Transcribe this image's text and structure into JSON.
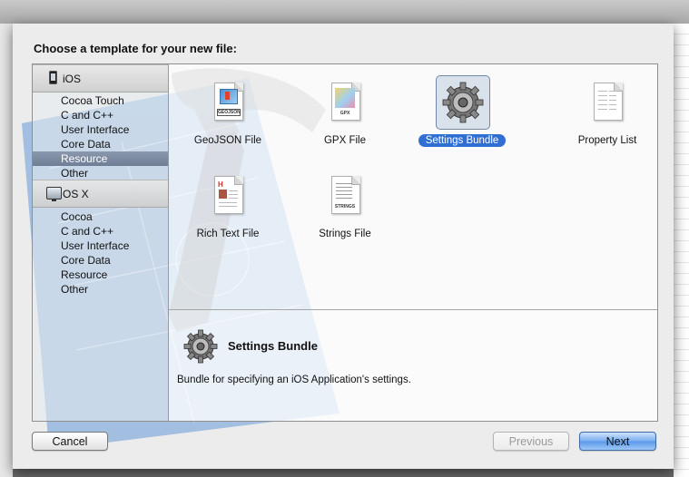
{
  "dialog": {
    "title": "Choose a template for your new file:"
  },
  "sidebar": {
    "sections": [
      {
        "name": "iOS",
        "icon": "ios-device-icon",
        "items": [
          "Cocoa Touch",
          "C and C++",
          "User Interface",
          "Core Data",
          "Resource",
          "Other"
        ],
        "selected": "Resource"
      },
      {
        "name": "OS X",
        "icon": "mac-display-icon",
        "items": [
          "Cocoa",
          "C and C++",
          "User Interface",
          "Core Data",
          "Resource",
          "Other"
        ]
      }
    ]
  },
  "templates": [
    {
      "name": "GeoJSON File",
      "icon": "geojson-file-icon",
      "tag": "GEOJSON"
    },
    {
      "name": "GPX File",
      "icon": "gpx-file-icon",
      "tag": "GPX"
    },
    {
      "name": "Settings Bundle",
      "icon": "settings-gear-icon",
      "selected": true
    },
    {
      "name": "Property List",
      "icon": "property-list-file-icon"
    },
    {
      "name": "Rich Text File",
      "icon": "rich-text-file-icon"
    },
    {
      "name": "Strings File",
      "icon": "strings-file-icon",
      "tag": "STRINGS"
    }
  ],
  "description": {
    "title": "Settings Bundle",
    "text": "Bundle for specifying an iOS Application's settings."
  },
  "buttons": {
    "cancel": "Cancel",
    "previous": "Previous",
    "next": "Next"
  },
  "colors": {
    "selection": "#2f6fd3",
    "sidebar_selected": "#7a88a0"
  }
}
